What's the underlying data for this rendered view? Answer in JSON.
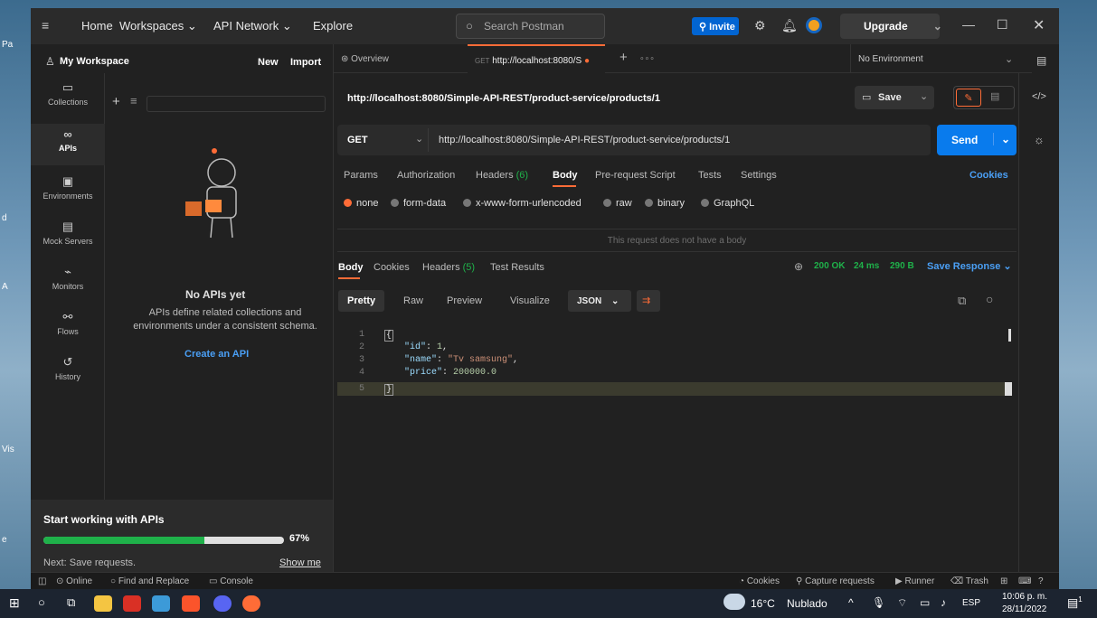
{
  "desktop": {
    "labels": [
      "Pa",
      "A",
      "d",
      "Vis",
      "e"
    ]
  },
  "titlebar": {
    "menu_icon": "hamburger-icon",
    "home": "Home",
    "workspaces": "Workspaces",
    "api_network": "API Network",
    "explore": "Explore",
    "search_placeholder": "Search Postman",
    "invite": "Invite",
    "upgrade": "Upgrade"
  },
  "sidebar": {
    "workspace_name": "My Workspace",
    "new_label": "New",
    "import_label": "Import",
    "rail": [
      {
        "label": "Collections",
        "icon": "collections-icon"
      },
      {
        "label": "APIs",
        "icon": "apis-icon"
      },
      {
        "label": "Environments",
        "icon": "environments-icon"
      },
      {
        "label": "Mock Servers",
        "icon": "mock-server-icon"
      },
      {
        "label": "Monitors",
        "icon": "monitor-icon"
      },
      {
        "label": "Flows",
        "icon": "flows-icon"
      },
      {
        "label": "History",
        "icon": "history-icon"
      }
    ],
    "empty_title": "No APIs yet",
    "empty_desc": "APIs define related collections and environments under a consistent schema.",
    "create_api": "Create an API",
    "onboarding": {
      "title": "Start working with APIs",
      "progress": 67,
      "progress_label": "67%",
      "next": "Next: Save requests.",
      "show_me": "Show me"
    }
  },
  "tabs": {
    "overview": "Overview",
    "active_method": "GET",
    "active_title": "http://localhost:8080/S",
    "environment": "No Environment"
  },
  "request": {
    "title": "http://localhost:8080/Simple-API-REST/product-service/products/1",
    "save": "Save",
    "method": "GET",
    "url": "http://localhost:8080/Simple-API-REST/product-service/products/1",
    "send": "Send",
    "subtabs": [
      "Params",
      "Authorization",
      "Headers",
      "Body",
      "Pre-request Script",
      "Tests",
      "Settings"
    ],
    "headers_count": "(6)",
    "cookies": "Cookies",
    "body_types": [
      "none",
      "form-data",
      "x-www-form-urlencoded",
      "raw",
      "binary",
      "GraphQL"
    ],
    "no_body": "This request does not have a body"
  },
  "response": {
    "tabs": [
      "Body",
      "Cookies",
      "Headers",
      "Test Results"
    ],
    "headers_count": "(5)",
    "status": "200 OK",
    "time": "24 ms",
    "size": "290 B",
    "save_response": "Save Response",
    "views": [
      "Pretty",
      "Raw",
      "Preview",
      "Visualize"
    ],
    "format": "JSON",
    "line_numbers": [
      "1",
      "2",
      "3",
      "4",
      "5"
    ],
    "lines": {
      "open": "{",
      "id_key": "\"id\"",
      "id_val": "1",
      "name_key": "\"name\"",
      "name_val": "\"Tv samsung\"",
      "price_key": "\"price\"",
      "price_val": "200000.0",
      "close": "}"
    }
  },
  "statusbar": {
    "online": "Online",
    "find_replace": "Find and Replace",
    "console": "Console",
    "cookies": "Cookies",
    "capture": "Capture requests",
    "runner": "Runner",
    "trash": "Trash"
  },
  "taskbar": {
    "temperature": "16°C",
    "weather": "Nublado",
    "lang": "ESP",
    "time": "10:06 p. m.",
    "date": "28/11/2022",
    "notif_count": "1"
  },
  "colors": {
    "accent": "#ff6c37",
    "send": "#097bed",
    "ok": "#1fb14a",
    "link": "#4a9ff5"
  }
}
